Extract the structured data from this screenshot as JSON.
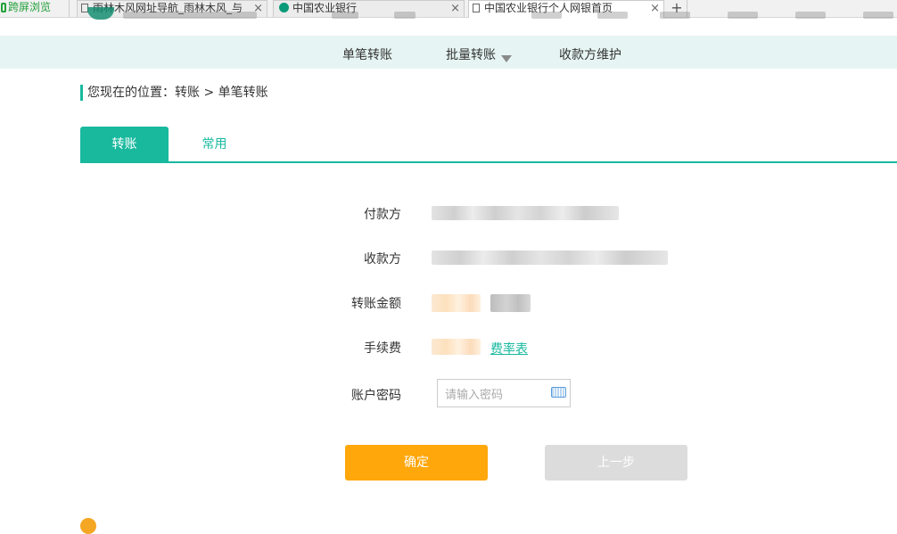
{
  "browser": {
    "tabs": [
      {
        "label": "跨屏浏览"
      },
      {
        "label": "雨林木风网址导航_雨林木风_与"
      },
      {
        "label": "中国农业银行"
      },
      {
        "label": "中国农业银行个人网银首页"
      }
    ],
    "new_tab_label": "+",
    "close_glyph": "×"
  },
  "subnav": {
    "items": [
      {
        "label": "单笔转账"
      },
      {
        "label": "批量转账"
      },
      {
        "label": "收款方维护"
      }
    ]
  },
  "breadcrumb": "您现在的位置：转账 > 单笔转账",
  "page_tabs": [
    {
      "label": "转账",
      "active": true
    },
    {
      "label": "常用",
      "active": false
    }
  ],
  "form": {
    "payer_label": "付款方",
    "payee_label": "收款方",
    "amount_label": "转账金额",
    "fee_label": "手续费",
    "fee_rate_link": "费率表",
    "password_label": "账户密码",
    "password_placeholder": "请输入密码"
  },
  "buttons": {
    "confirm": "确定",
    "previous": "上一步"
  },
  "colors": {
    "accent": "#19b99e",
    "confirm_button": "#ffa70b",
    "disabled_button": "#dcdcdc",
    "subnav_bg": "#e6f5f3"
  }
}
